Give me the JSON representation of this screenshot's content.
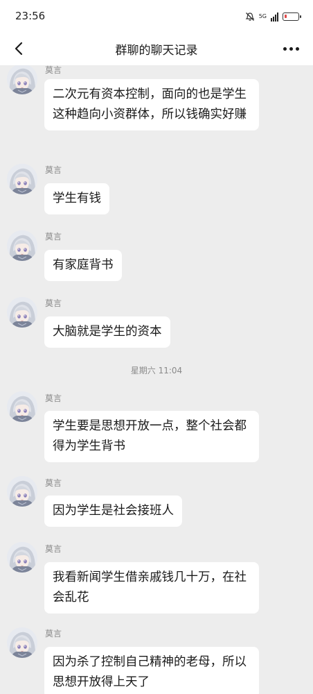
{
  "status_bar": {
    "time": "23:56",
    "network": "5G",
    "icons": [
      "mute-icon",
      "signal-icon",
      "battery-icon"
    ]
  },
  "header": {
    "title": "群聊的聊天记录",
    "back_icon": "back-arrow-icon",
    "more_icon": "more-dots-icon"
  },
  "messages": [
    {
      "sender": "莫言",
      "text": "二次元有资本控制，面向的也是学生这种趋向小资群体，所以钱确实好赚"
    },
    {
      "sender": "莫言",
      "text": "学生有钱"
    },
    {
      "sender": "莫言",
      "text": "有家庭背书"
    },
    {
      "sender": "莫言",
      "text": "大脑就是学生的资本"
    },
    {
      "sender": "莫言",
      "text": "学生要是思想开放一点，整个社会都得为学生背书"
    },
    {
      "sender": "莫言",
      "text": "因为学生是社会接班人"
    },
    {
      "sender": "莫言",
      "text": "我看新闻学生借亲戚钱几十万，在社会乱花"
    },
    {
      "sender": "莫言",
      "text": "因为杀了控制自己精神的老母，所以思想开放得上天了"
    }
  ],
  "time_divider": "星期六 11:04",
  "colors": {
    "background": "#ededed",
    "bubble": "#ffffff",
    "meta_text": "#8a8a8a",
    "battery_low": "#e04848"
  }
}
